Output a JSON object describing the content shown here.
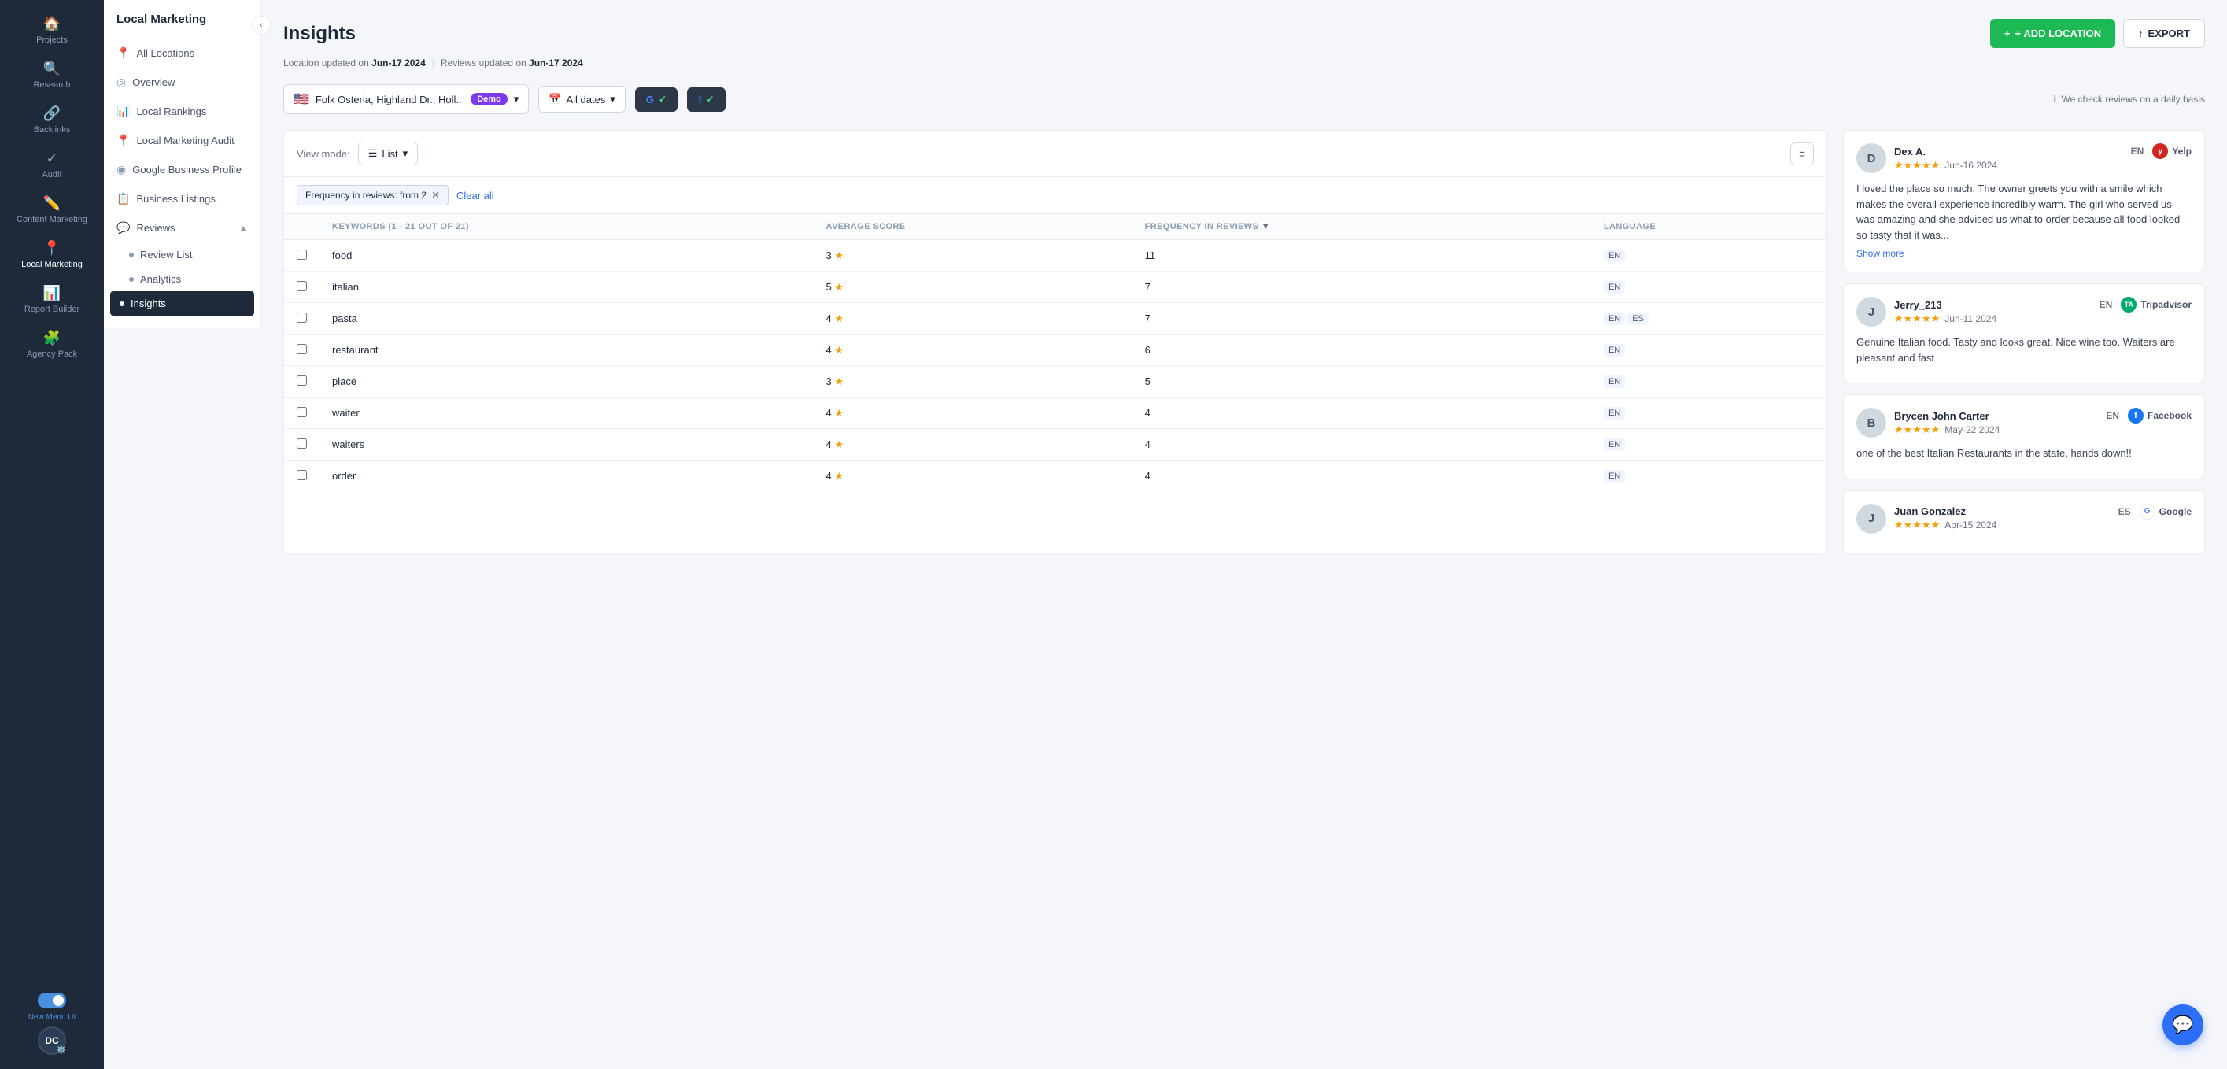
{
  "sidebar": {
    "items": [
      {
        "id": "projects",
        "label": "Projects",
        "icon": "🏠"
      },
      {
        "id": "research",
        "label": "Research",
        "icon": "🔍"
      },
      {
        "id": "backlinks",
        "label": "Backlinks",
        "icon": "🔗"
      },
      {
        "id": "audit",
        "label": "Audit",
        "icon": "✓"
      },
      {
        "id": "content-marketing",
        "label": "Content Marketing",
        "icon": "✏️"
      },
      {
        "id": "local-marketing",
        "label": "Local Marketing",
        "icon": "📍"
      },
      {
        "id": "report-builder",
        "label": "Report Builder",
        "icon": "📊"
      },
      {
        "id": "agency-pack",
        "label": "Agency Pack",
        "icon": "🧩"
      }
    ],
    "toggle_label": "New Menu UI",
    "avatar_initials": "DC"
  },
  "second_panel": {
    "title": "Local Marketing",
    "nav_items": [
      {
        "id": "all-locations",
        "label": "All Locations",
        "icon": "📍"
      },
      {
        "id": "overview",
        "label": "Overview",
        "icon": "◎"
      },
      {
        "id": "local-rankings",
        "label": "Local Rankings",
        "icon": "📊"
      },
      {
        "id": "local-marketing-audit",
        "label": "Local Marketing Audit",
        "icon": "📍"
      },
      {
        "id": "google-business-profile",
        "label": "Google Business Profile",
        "icon": "◉"
      },
      {
        "id": "business-listings",
        "label": "Business Listings",
        "icon": "📋"
      },
      {
        "id": "reviews",
        "label": "Reviews",
        "icon": "💬",
        "expanded": true
      },
      {
        "id": "review-list",
        "label": "Review List",
        "sub": true
      },
      {
        "id": "analytics",
        "label": "Analytics",
        "sub": true
      },
      {
        "id": "insights",
        "label": "Insights",
        "sub": true,
        "active": true
      }
    ]
  },
  "page": {
    "title": "Insights",
    "location_updated": "Jun-17 2024",
    "reviews_updated": "Jun-17 2024"
  },
  "header_actions": {
    "add_location": "+ ADD LOCATION",
    "export": "EXPORT"
  },
  "toolbar": {
    "location_name": "Folk Osteria, Highland Dr., Holl...",
    "location_demo_badge": "Demo",
    "date_filter": "All dates",
    "info_note": "We check reviews on a daily basis"
  },
  "view_mode": {
    "label": "View mode:",
    "value": "List"
  },
  "filter_chip": {
    "label": "Frequency in reviews: from 2",
    "clear_all": "Clear all"
  },
  "table": {
    "headers": [
      {
        "id": "keyword",
        "label": "KEYWORDS (1 - 21 OUT OF 21)"
      },
      {
        "id": "avg-score",
        "label": "AVERAGE SCORE"
      },
      {
        "id": "frequency",
        "label": "FREQUENCY IN REVIEWS"
      },
      {
        "id": "language",
        "label": "LANGUAGE"
      }
    ],
    "rows": [
      {
        "keyword": "food",
        "avg_score": 3,
        "frequency": 11,
        "languages": [
          "EN"
        ]
      },
      {
        "keyword": "italian",
        "avg_score": 5,
        "frequency": 7,
        "languages": [
          "EN"
        ]
      },
      {
        "keyword": "pasta",
        "avg_score": 4,
        "frequency": 7,
        "languages": [
          "EN",
          "ES"
        ]
      },
      {
        "keyword": "restaurant",
        "avg_score": 4,
        "frequency": 6,
        "languages": [
          "EN"
        ]
      },
      {
        "keyword": "place",
        "avg_score": 3,
        "frequency": 5,
        "languages": [
          "EN"
        ]
      },
      {
        "keyword": "waiter",
        "avg_score": 4,
        "frequency": 4,
        "languages": [
          "EN"
        ]
      },
      {
        "keyword": "waiters",
        "avg_score": 4,
        "frequency": 4,
        "languages": [
          "EN"
        ]
      },
      {
        "keyword": "order",
        "avg_score": 4,
        "frequency": 4,
        "languages": [
          "EN"
        ]
      }
    ]
  },
  "reviews": [
    {
      "id": "review-1",
      "avatar_initial": "D",
      "name": "Dex A.",
      "language": "EN",
      "platform": "Yelp",
      "rating": 5,
      "date": "Jun-16 2024",
      "body": "I loved the place so much. The owner greets you with a smile which makes the overall experience incredibly warm. The girl who served us was amazing and she advised us what to order because all food looked so tasty that it was...",
      "show_more": true
    },
    {
      "id": "review-2",
      "avatar_initial": "J",
      "name": "Jerry_213",
      "language": "EN",
      "platform": "Tripadvisor",
      "rating": 5,
      "date": "Jun-11 2024",
      "body": "Genuine Italian food. Tasty and looks great. Nice wine too. Waiters are pleasant and fast",
      "show_more": false
    },
    {
      "id": "review-3",
      "avatar_initial": "B",
      "name": "Brycen John Carter",
      "language": "EN",
      "platform": "Facebook",
      "rating": 5,
      "date": "May-22 2024",
      "body": "one of the best Italian Restaurants in the state, hands down!!",
      "show_more": false
    },
    {
      "id": "review-4",
      "avatar_initial": "J",
      "name": "Juan Gonzalez",
      "language": "ES",
      "platform": "Google",
      "rating": 5,
      "date": "Apr-15 2024",
      "body": "",
      "show_more": false
    }
  ]
}
